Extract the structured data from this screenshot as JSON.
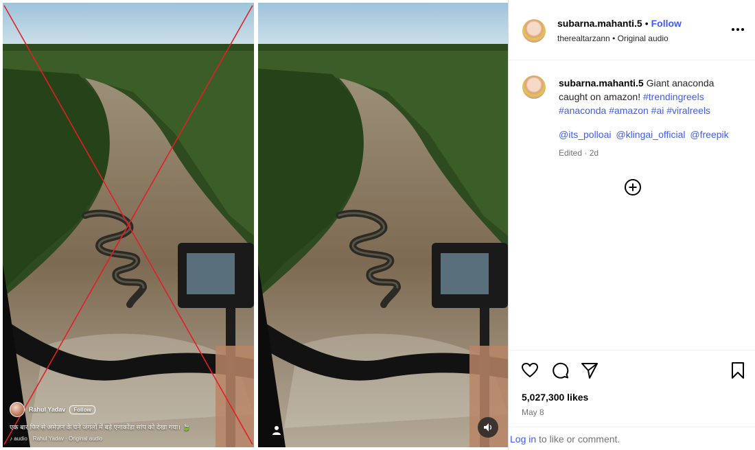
{
  "left_reel": {
    "username": "Rahul Yadav ",
    "follow_label": "Follow",
    "caption": "एक बार फिर से अमेज़न के घने जंगलों में बड़े एनाकोंडा सांप को देखा गया। ",
    "caption_emoji": "🍃",
    "audio_prefix": "♪ audio",
    "audio_label": "Rahul Yadav · Original audio"
  },
  "post": {
    "username": "subarna.mahanti.5",
    "separator": "•",
    "follow_label": "Follow",
    "audio_user": "therealtarzann",
    "audio_label": "Original audio",
    "more_icon": "more-horizontal-icon",
    "caption_user": "subarna.mahanti.5",
    "caption_text": " Giant anaconda caught on amazon! ",
    "hashtags": [
      "#trendingreels",
      "#anaconda",
      "#amazon",
      "#ai",
      "#viralreels"
    ],
    "mentions": [
      "@its_polloai",
      "@klingai_official",
      "@freepik"
    ],
    "edited": "Edited · 2d",
    "likes": "5,027,300 likes",
    "date": "May 8",
    "login_link": "Log in",
    "login_rest": " to like or comment."
  },
  "icons": {
    "heart": "heart-icon",
    "comment": "comment-icon",
    "share": "share-icon",
    "bookmark": "bookmark-icon",
    "plus": "add-circle-icon",
    "mute": "speaker-icon",
    "person": "tagged-user-icon"
  },
  "colors": {
    "link": "#3d5bf5",
    "cross": "#e31e24",
    "muted_text": "#737373"
  }
}
